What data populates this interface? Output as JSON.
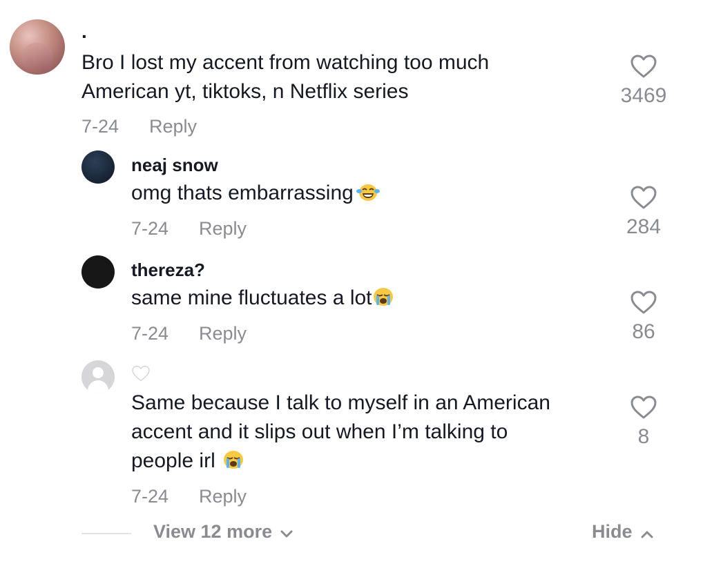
{
  "comments": [
    {
      "username": ".",
      "text_lines": [
        "Bro I lost my accent from watching too much",
        "American yt, tiktoks, n Netflix series"
      ],
      "date": "7-24",
      "reply_label": "Reply",
      "likes": "3469",
      "avatar": "photo-avatar-icon"
    },
    {
      "username": "neaj snow",
      "text_lines": [
        "omg thats embarrassing"
      ],
      "emoji": "face-with-tears-of-joy-icon",
      "date": "7-24",
      "reply_label": "Reply",
      "likes": "284",
      "avatar": "navy-avatar-icon"
    },
    {
      "username": "thereza?",
      "text_lines": [
        "same mine fluctuates a lot"
      ],
      "emoji": "loudly-crying-face-icon",
      "date": "7-24",
      "reply_label": "Reply",
      "likes": "86",
      "avatar": "dark-avatar-icon"
    },
    {
      "username_icon": "white-heart-icon",
      "text_lines": [
        "Same because I talk to myself in an American",
        "accent and it slips out when I’m talking to",
        "people irl"
      ],
      "emoji": "loudly-crying-face-icon",
      "date": "7-24",
      "reply_label": "Reply",
      "likes": "8",
      "avatar": "default-avatar-icon"
    }
  ],
  "footer": {
    "view_more_label": "View 12 more",
    "hide_label": "Hide"
  },
  "colors": {
    "text_primary": "#161823",
    "text_secondary": "#8a8b91",
    "divider": "#e3e3e4"
  }
}
